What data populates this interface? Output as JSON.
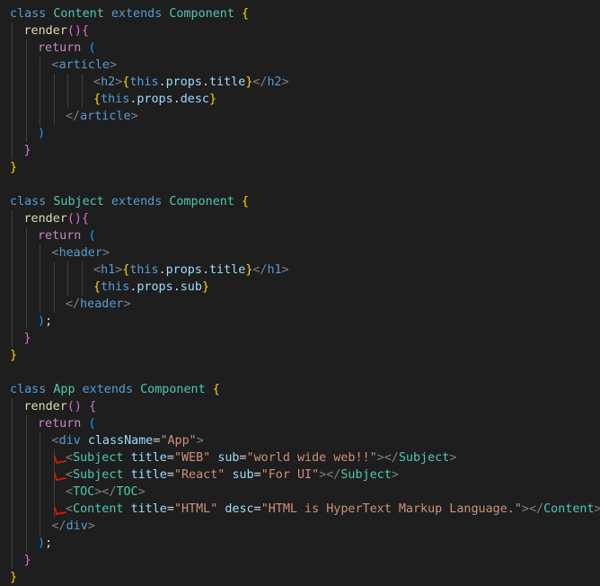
{
  "editor": {
    "theme_colors": {
      "background": "#1e1e1e",
      "keyword": "#569cd6",
      "control": "#c586c0",
      "class_name": "#4ec9b0",
      "function": "#dcdcaa",
      "tag": "#808080",
      "tag_name": "#569cd6",
      "attribute": "#9cdcfe",
      "string": "#ce9178",
      "variable": "#9cdcfe",
      "text": "#d4d4d4",
      "bracket_gold": "#ffd700",
      "bracket_purple": "#da70d6",
      "bracket_blue": "#179fff",
      "annotation_mark": "#e51400"
    },
    "lines": [
      {
        "indent": 0,
        "tokens": [
          {
            "t": "class ",
            "c": "keyword"
          },
          {
            "t": "Content ",
            "c": "class_name"
          },
          {
            "t": "extends ",
            "c": "keyword"
          },
          {
            "t": "Component ",
            "c": "class_name"
          },
          {
            "t": "{",
            "c": "bracket_gold"
          }
        ]
      },
      {
        "indent": 1,
        "tokens": [
          {
            "t": "render",
            "c": "function"
          },
          {
            "t": "()",
            "c": "bracket_purple"
          },
          {
            "t": "{",
            "c": "bracket_purple"
          }
        ]
      },
      {
        "indent": 2,
        "tokens": [
          {
            "t": "return ",
            "c": "control"
          },
          {
            "t": "(",
            "c": "bracket_blue"
          }
        ]
      },
      {
        "indent": 3,
        "tokens": [
          {
            "t": "<",
            "c": "tag"
          },
          {
            "t": "article",
            "c": "tag_name"
          },
          {
            "t": ">",
            "c": "tag"
          }
        ]
      },
      {
        "indent": 6,
        "tokens": [
          {
            "t": "<",
            "c": "tag"
          },
          {
            "t": "h2",
            "c": "tag_name"
          },
          {
            "t": ">",
            "c": "tag"
          },
          {
            "t": "{",
            "c": "bracket_gold"
          },
          {
            "t": "this",
            "c": "keyword"
          },
          {
            "t": ".",
            "c": "text"
          },
          {
            "t": "props",
            "c": "variable"
          },
          {
            "t": ".",
            "c": "text"
          },
          {
            "t": "title",
            "c": "variable"
          },
          {
            "t": "}",
            "c": "bracket_gold"
          },
          {
            "t": "</",
            "c": "tag"
          },
          {
            "t": "h2",
            "c": "tag_name"
          },
          {
            "t": ">",
            "c": "tag"
          }
        ]
      },
      {
        "indent": 6,
        "tokens": [
          {
            "t": "{",
            "c": "bracket_gold"
          },
          {
            "t": "this",
            "c": "keyword"
          },
          {
            "t": ".",
            "c": "text"
          },
          {
            "t": "props",
            "c": "variable"
          },
          {
            "t": ".",
            "c": "text"
          },
          {
            "t": "desc",
            "c": "variable"
          },
          {
            "t": "}",
            "c": "bracket_gold"
          }
        ]
      },
      {
        "indent": 4,
        "tokens": [
          {
            "t": "</",
            "c": "tag"
          },
          {
            "t": "article",
            "c": "tag_name"
          },
          {
            "t": ">",
            "c": "tag"
          }
        ]
      },
      {
        "indent": 2,
        "tokens": [
          {
            "t": ")",
            "c": "bracket_blue"
          }
        ]
      },
      {
        "indent": 1,
        "tokens": [
          {
            "t": "}",
            "c": "bracket_purple"
          }
        ]
      },
      {
        "indent": 0,
        "tokens": [
          {
            "t": "}",
            "c": "bracket_gold"
          }
        ]
      },
      {
        "indent": 0,
        "tokens": []
      },
      {
        "indent": 0,
        "tokens": [
          {
            "t": "class ",
            "c": "keyword"
          },
          {
            "t": "Subject ",
            "c": "class_name"
          },
          {
            "t": "extends ",
            "c": "keyword"
          },
          {
            "t": "Component ",
            "c": "class_name"
          },
          {
            "t": "{",
            "c": "bracket_gold"
          }
        ]
      },
      {
        "indent": 1,
        "tokens": [
          {
            "t": "render",
            "c": "function"
          },
          {
            "t": "()",
            "c": "bracket_purple"
          },
          {
            "t": "{",
            "c": "bracket_purple"
          }
        ]
      },
      {
        "indent": 2,
        "tokens": [
          {
            "t": "return ",
            "c": "control"
          },
          {
            "t": "(",
            "c": "bracket_blue"
          }
        ]
      },
      {
        "indent": 3,
        "tokens": [
          {
            "t": "<",
            "c": "tag"
          },
          {
            "t": "header",
            "c": "tag_name"
          },
          {
            "t": ">",
            "c": "tag"
          }
        ]
      },
      {
        "indent": 6,
        "tokens": [
          {
            "t": "<",
            "c": "tag"
          },
          {
            "t": "h1",
            "c": "tag_name"
          },
          {
            "t": ">",
            "c": "tag"
          },
          {
            "t": "{",
            "c": "bracket_gold"
          },
          {
            "t": "this",
            "c": "keyword"
          },
          {
            "t": ".",
            "c": "text"
          },
          {
            "t": "props",
            "c": "variable"
          },
          {
            "t": ".",
            "c": "text"
          },
          {
            "t": "title",
            "c": "variable"
          },
          {
            "t": "}",
            "c": "bracket_gold"
          },
          {
            "t": "</",
            "c": "tag"
          },
          {
            "t": "h1",
            "c": "tag_name"
          },
          {
            "t": ">",
            "c": "tag"
          }
        ]
      },
      {
        "indent": 6,
        "tokens": [
          {
            "t": "{",
            "c": "bracket_gold"
          },
          {
            "t": "this",
            "c": "keyword"
          },
          {
            "t": ".",
            "c": "text"
          },
          {
            "t": "props",
            "c": "variable"
          },
          {
            "t": ".",
            "c": "text"
          },
          {
            "t": "sub",
            "c": "variable"
          },
          {
            "t": "}",
            "c": "bracket_gold"
          }
        ]
      },
      {
        "indent": 4,
        "tokens": [
          {
            "t": "</",
            "c": "tag"
          },
          {
            "t": "header",
            "c": "tag_name"
          },
          {
            "t": ">",
            "c": "tag"
          }
        ]
      },
      {
        "indent": 2,
        "tokens": [
          {
            "t": ")",
            "c": "bracket_blue"
          },
          {
            "t": ";",
            "c": "text"
          }
        ]
      },
      {
        "indent": 1,
        "tokens": [
          {
            "t": "}",
            "c": "bracket_purple"
          }
        ]
      },
      {
        "indent": 0,
        "tokens": [
          {
            "t": "}",
            "c": "bracket_gold"
          }
        ]
      },
      {
        "indent": 0,
        "tokens": []
      },
      {
        "indent": 0,
        "tokens": [
          {
            "t": "class ",
            "c": "keyword"
          },
          {
            "t": "App ",
            "c": "class_name"
          },
          {
            "t": "extends ",
            "c": "keyword"
          },
          {
            "t": "Component ",
            "c": "class_name"
          },
          {
            "t": "{",
            "c": "bracket_gold"
          }
        ]
      },
      {
        "indent": 1,
        "tokens": [
          {
            "t": "render",
            "c": "function"
          },
          {
            "t": "() ",
            "c": "bracket_purple"
          },
          {
            "t": "{",
            "c": "bracket_purple"
          }
        ]
      },
      {
        "indent": 2,
        "tokens": [
          {
            "t": "return ",
            "c": "control"
          },
          {
            "t": "(",
            "c": "bracket_blue"
          }
        ]
      },
      {
        "indent": 3,
        "tokens": [
          {
            "t": "<",
            "c": "tag"
          },
          {
            "t": "div ",
            "c": "tag_name"
          },
          {
            "t": "className",
            "c": "attribute"
          },
          {
            "t": "=",
            "c": "text"
          },
          {
            "t": "\"App\"",
            "c": "string"
          },
          {
            "t": ">",
            "c": "tag"
          }
        ]
      },
      {
        "indent": 4,
        "mark": true,
        "tokens": [
          {
            "t": "<",
            "c": "tag"
          },
          {
            "t": "Subject ",
            "c": "class_name"
          },
          {
            "t": "title",
            "c": "attribute"
          },
          {
            "t": "=",
            "c": "text"
          },
          {
            "t": "\"WEB\" ",
            "c": "string"
          },
          {
            "t": "sub",
            "c": "attribute"
          },
          {
            "t": "=",
            "c": "text"
          },
          {
            "t": "\"world wide web!!\"",
            "c": "string"
          },
          {
            "t": "></",
            "c": "tag"
          },
          {
            "t": "Subject",
            "c": "class_name"
          },
          {
            "t": ">",
            "c": "tag"
          }
        ]
      },
      {
        "indent": 4,
        "mark": true,
        "tokens": [
          {
            "t": "<",
            "c": "tag"
          },
          {
            "t": "Subject ",
            "c": "class_name"
          },
          {
            "t": "title",
            "c": "attribute"
          },
          {
            "t": "=",
            "c": "text"
          },
          {
            "t": "\"React\" ",
            "c": "string"
          },
          {
            "t": "sub",
            "c": "attribute"
          },
          {
            "t": "=",
            "c": "text"
          },
          {
            "t": "\"For UI\"",
            "c": "string"
          },
          {
            "t": "></",
            "c": "tag"
          },
          {
            "t": "Subject",
            "c": "class_name"
          },
          {
            "t": ">",
            "c": "tag"
          }
        ]
      },
      {
        "indent": 4,
        "tokens": [
          {
            "t": "<",
            "c": "tag"
          },
          {
            "t": "TOC",
            "c": "class_name"
          },
          {
            "t": "></",
            "c": "tag"
          },
          {
            "t": "TOC",
            "c": "class_name"
          },
          {
            "t": ">",
            "c": "tag"
          }
        ]
      },
      {
        "indent": 4,
        "mark": true,
        "tokens": [
          {
            "t": "<",
            "c": "tag"
          },
          {
            "t": "Content ",
            "c": "class_name"
          },
          {
            "t": "title",
            "c": "attribute"
          },
          {
            "t": "=",
            "c": "text"
          },
          {
            "t": "\"HTML\" ",
            "c": "string"
          },
          {
            "t": "desc",
            "c": "attribute"
          },
          {
            "t": "=",
            "c": "text"
          },
          {
            "t": "\"HTML is HyperText Markup Language.\"",
            "c": "string"
          },
          {
            "t": "></",
            "c": "tag"
          },
          {
            "t": "Content",
            "c": "class_name"
          },
          {
            "t": ">",
            "c": "tag"
          }
        ]
      },
      {
        "indent": 3,
        "tokens": [
          {
            "t": "</",
            "c": "tag"
          },
          {
            "t": "div",
            "c": "tag_name"
          },
          {
            "t": ">",
            "c": "tag"
          }
        ]
      },
      {
        "indent": 2,
        "tokens": [
          {
            "t": ")",
            "c": "bracket_blue"
          },
          {
            "t": ";",
            "c": "text"
          }
        ]
      },
      {
        "indent": 1,
        "tokens": [
          {
            "t": "}",
            "c": "bracket_purple"
          }
        ]
      },
      {
        "indent": 0,
        "tokens": [
          {
            "t": "}",
            "c": "bracket_gold"
          }
        ]
      }
    ]
  }
}
